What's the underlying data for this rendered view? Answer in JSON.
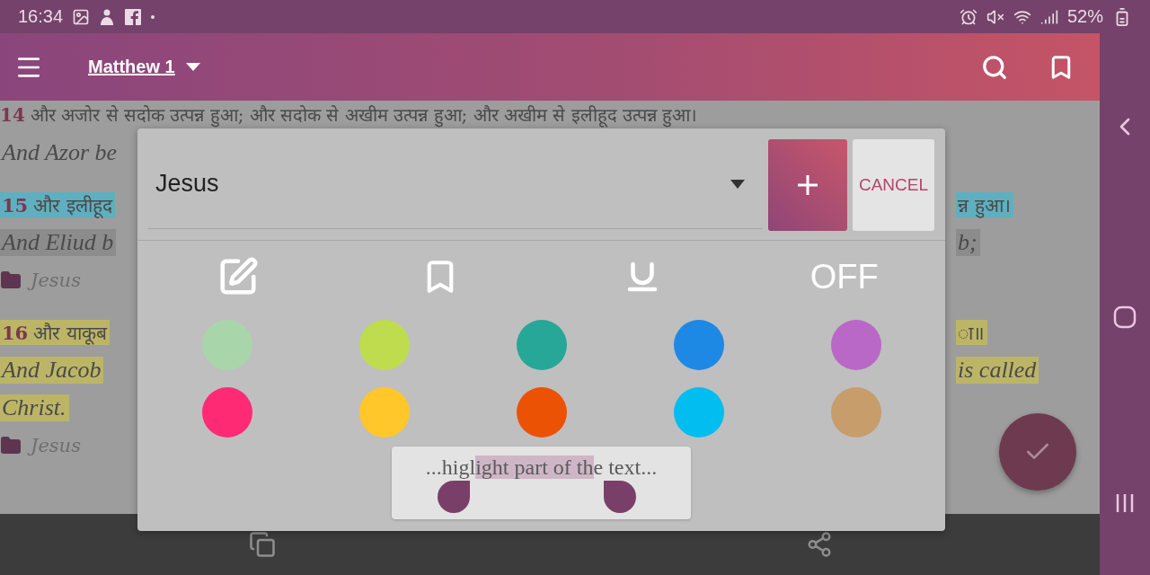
{
  "status_bar": {
    "time": "16:34",
    "battery": "52%"
  },
  "toolbar": {
    "title": "Matthew 1"
  },
  "lines": [
    {
      "kind": "hindi",
      "number": "14",
      "text": "और अजोर से सदोक उत्पन्न हुआ; और सदोक से अखीम उत्पन्न हुआ; और अखीम से इलीहूद उत्पन्न हुआ।"
    },
    {
      "kind": "english",
      "left": "And Azor be"
    },
    {
      "kind": "hindi",
      "number": "15",
      "left": "और इलीहूद",
      "right": "न्न हुआ।",
      "color": "#5fafc0"
    },
    {
      "kind": "english",
      "left": "And Eliud b",
      "right": "b;",
      "color": "#8c8c8c"
    },
    {
      "kind": "tag",
      "label": "Jesus"
    },
    {
      "kind": "hindi",
      "number": "16",
      "left": "और याकूब",
      "right": "ा॥",
      "color": "#bdb566"
    },
    {
      "kind": "english",
      "left": "And Jacob",
      "right": "is called",
      "color": "#bdb566"
    },
    {
      "kind": "english",
      "left": "Christ.",
      "color": "#bdb566"
    },
    {
      "kind": "tag",
      "label": "Jesus"
    }
  ],
  "dialog": {
    "tag_field": {
      "value": "Jesus"
    },
    "cancel_button": "CANCEL",
    "tools": [
      {
        "kind": "edit"
      },
      {
        "kind": "bookmark"
      },
      {
        "kind": "underline"
      },
      {
        "kind": "text",
        "label": "OFF"
      }
    ],
    "colors": [
      {
        "color": "#a9d5ab"
      },
      {
        "color": "#bfdc4e"
      },
      {
        "color": "#26a797"
      },
      {
        "color": "#1e88e5"
      },
      {
        "color": "#b968c7"
      },
      {
        "color": "#ff2a74"
      },
      {
        "color": "#ffc729"
      },
      {
        "color": "#ec5203"
      },
      {
        "color": "#01bdf0"
      },
      {
        "color": "#c79d6c"
      }
    ],
    "preview": {
      "before": "...higl",
      "highlighted": "ight part of th",
      "after": "e text..."
    }
  }
}
